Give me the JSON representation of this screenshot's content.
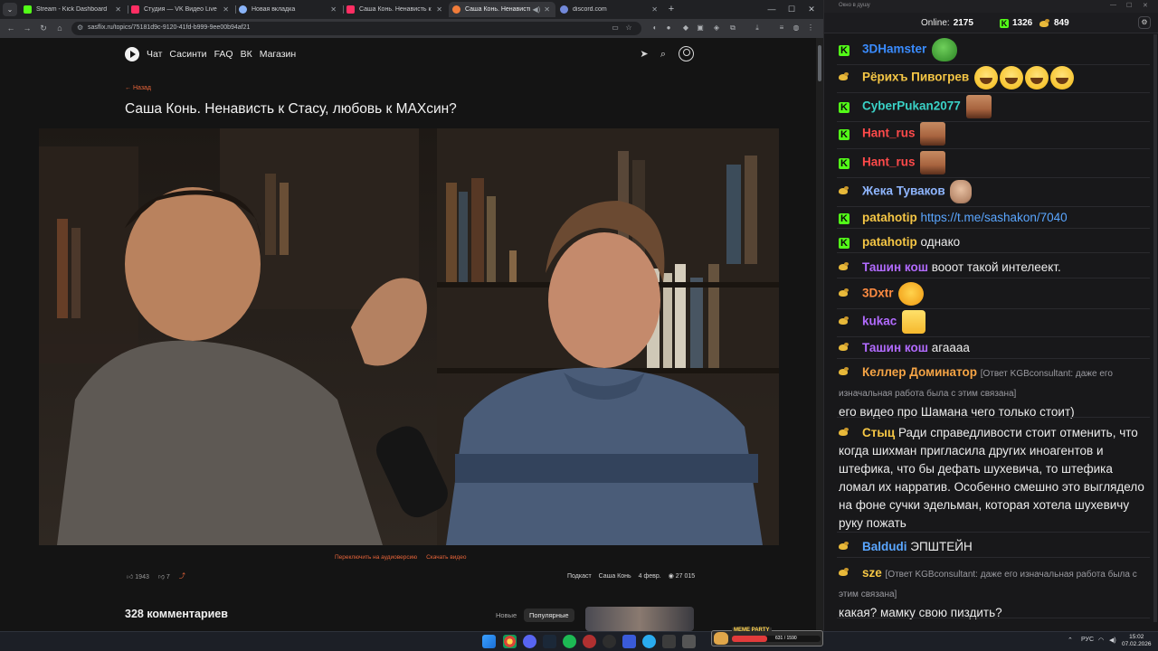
{
  "browser": {
    "tabs": [
      {
        "title": "Stream - Kick Dashboard",
        "favicon_color": "#53fc18"
      },
      {
        "title": "Студия — VK Видео Live",
        "favicon_color": "#ff2e63"
      },
      {
        "title": "Новая вкладка",
        "favicon_color": "#8ab4f8"
      },
      {
        "title": "Саша Конь. Ненависть к Стасу",
        "favicon_color": "#ff2e63"
      },
      {
        "title": "Саша Конь. Ненависть к С",
        "favicon_color": "#f07c3a"
      },
      {
        "title": "discord.com",
        "favicon_color": "#7289da"
      }
    ],
    "url": "sasflix.ru/topics/75181d9c-9120-41fd-b999-9ee00b94af21"
  },
  "site": {
    "nav": [
      "Чат",
      "Сасинти",
      "FAQ",
      "ВК",
      "Магазин"
    ],
    "back": "← Назад",
    "title": "Саша Конь. Ненависть к Стасу, любовь к МАХсин?",
    "audio_link": "Переключить на аудиоверсию",
    "download_link": "Скачать видео",
    "likes": "1943",
    "dislikes": "7",
    "category": "Подкаст",
    "author": "Саша Конь",
    "date": "4 февр.",
    "views": "27 015",
    "comments_count": "328 комментариев",
    "sort_new": "Новые",
    "sort_popular": "Популярные"
  },
  "chat": {
    "window_title": "Окно в душу",
    "online_label": "Online:",
    "online": "2175",
    "kick_viewers": "1326",
    "vk_viewers": "849",
    "messages": [
      {
        "platform": "kick",
        "user": "3DHamster",
        "color": "#3a8cff",
        "text": "",
        "emotes": [
          "pepe"
        ]
      },
      {
        "platform": "vk",
        "user": "Рёрихъ Пивогрев",
        "color": "#f5c645",
        "text": "",
        "emotes": [
          "smile",
          "smile",
          "smile",
          "smile"
        ]
      },
      {
        "platform": "kick",
        "user": "CyberPukan2077",
        "color": "#3ad1c6",
        "text": "",
        "emotes": [
          "face"
        ]
      },
      {
        "platform": "kick",
        "user": "Hant_rus",
        "color": "#ff4a4a",
        "text": "",
        "emotes": [
          "face"
        ]
      },
      {
        "platform": "kick",
        "user": "Hant_rus",
        "color": "#ff4a4a",
        "text": "",
        "emotes": [
          "face"
        ]
      },
      {
        "platform": "vk",
        "user": "Жека Туваков",
        "color": "#8fb6ff",
        "text": "",
        "emotes": [
          "bald"
        ]
      },
      {
        "platform": "kick",
        "user": "patahotip",
        "color": "#f5c645",
        "text": "https://t.me/sashakon/7040",
        "emotes": []
      },
      {
        "platform": "kick",
        "user": "patahotip",
        "color": "#f5c645",
        "text": "однако",
        "emotes": []
      },
      {
        "platform": "vk",
        "user": "Ташин кош",
        "color": "#b26bff",
        "text": "вооот такой интелеект.",
        "emotes": []
      },
      {
        "platform": "vk",
        "user": "3Dxtr",
        "color": "#ff8c42",
        "text": "",
        "emotes": [
          "laugh"
        ]
      },
      {
        "platform": "vk",
        "user": "kukac",
        "color": "#b26bff",
        "text": "",
        "emotes": [
          "squint"
        ]
      },
      {
        "platform": "vk",
        "user": "Ташин кош",
        "color": "#b26bff",
        "text": "агаааа",
        "emotes": []
      },
      {
        "platform": "vk",
        "user": "Келлер Доминатор",
        "color": "#f5a445",
        "reply": "[Ответ KGBconsultant: даже его изначальная работа была с этим связана]",
        "text": "его видео про Шамана чего только стоит)"
      },
      {
        "platform": "vk",
        "user": "Стыц",
        "color": "#f5c645",
        "text": "Ради справедливости стоит отменить, что когда шихман пригласила других иноагентов и штефика, что бы дефать шухевича, то штефика ломал их нарратив. Особенно смешно это выглядело на фоне сучки эдельман, которая хотела шухевичу руку пожать"
      },
      {
        "platform": "vk",
        "user": "Baldudi",
        "color": "#5aa6ff",
        "text": "ЭПШТЕЙН",
        "emotes": []
      },
      {
        "platform": "vk",
        "user": "sze",
        "color": "#f5c645",
        "reply": "[Ответ KGBconsultant: даже его изначальная работа была с этим связана]",
        "text": "какая? мамку свою пиздить?"
      }
    ]
  },
  "taskbar": {
    "meme_label": "MEME PARTY",
    "meme_value": "631 / 1590",
    "meme_progress": 0.4,
    "lang": "РУС",
    "time": "15:02",
    "date": "07.02.2026"
  },
  "colors": {
    "accent": "#e8653a",
    "kick_green": "#53fc18",
    "link": "#5aa6ff"
  }
}
